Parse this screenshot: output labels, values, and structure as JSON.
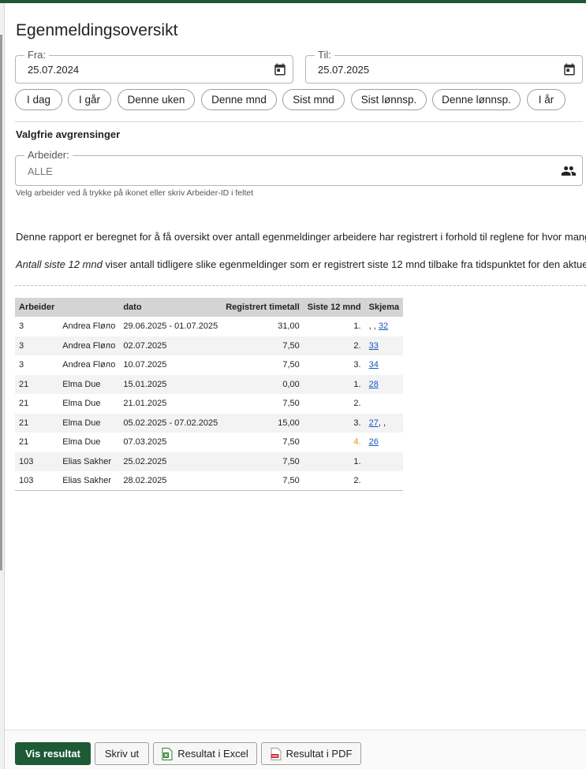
{
  "title": "Egenmeldingsoversikt",
  "date_from": {
    "label": "Fra:",
    "value": "25.07.2024"
  },
  "date_to": {
    "label": "Til:",
    "value": "25.07.2025"
  },
  "quick_ranges": [
    "I dag",
    "I går",
    "Denne uken",
    "Denne mnd",
    "Sist mnd",
    "Sist lønnsp.",
    "Denne lønnsp.",
    "I år"
  ],
  "optional_heading": "Valgfrie avgrensinger",
  "worker_field": {
    "label": "Arbeider:",
    "value": "ALLE",
    "hint": "Velg arbeider ved å trykke på ikonet eller skriv Arbeider-ID i feltet"
  },
  "description": {
    "line1": "Denne rapport er beregnet for å få oversikt over antall egenmeldinger arbeidere har registrert i forhold til reglene for hvor mange d",
    "line2_em": "Antall siste 12 mnd",
    "line2_rest": " viser antall tidligere slike egenmeldinger som er registrert siste 12 mnd tilbake fra tidspunktet for den aktuelle e"
  },
  "table": {
    "headers": [
      "Arbeider",
      "dato",
      "Registrert timetall",
      "Siste 12 mnd",
      "Skjema"
    ],
    "rows": [
      {
        "id": "3",
        "name": "Andrea Fløло",
        "date": "29.06.2025 - 01.07.2025",
        "hours": "31,00",
        "count": "1.",
        "pre": ", , ",
        "link": "32",
        "post": "",
        "warn": false
      },
      {
        "id": "3",
        "name": "Andrea Fløло",
        "date": "02.07.2025",
        "hours": "7,50",
        "count": "2.",
        "pre": "",
        "link": "33",
        "post": "",
        "warn": false
      },
      {
        "id": "3",
        "name": "Andrea Fløло",
        "date": "10.07.2025",
        "hours": "7,50",
        "count": "3.",
        "pre": "",
        "link": "34",
        "post": "",
        "warn": false
      },
      {
        "id": "21",
        "name": "Elma Due",
        "date": "15.01.2025",
        "hours": "0,00",
        "count": "1.",
        "pre": "",
        "link": "28",
        "post": "",
        "warn": false
      },
      {
        "id": "21",
        "name": "Elma Due",
        "date": "21.01.2025",
        "hours": "7,50",
        "count": "2.",
        "pre": "",
        "link": "",
        "post": "",
        "warn": false
      },
      {
        "id": "21",
        "name": "Elma Due",
        "date": "05.02.2025 - 07.02.2025",
        "hours": "15,00",
        "count": "3.",
        "pre": "",
        "link": "27",
        "post": ", ,",
        "warn": false
      },
      {
        "id": "21",
        "name": "Elma Due",
        "date": "07.03.2025",
        "hours": "7,50",
        "count": "4.",
        "pre": "",
        "link": "26",
        "post": "",
        "warn": true
      },
      {
        "id": "103",
        "name": "Elias Sakher",
        "date": "25.02.2025",
        "hours": "7,50",
        "count": "1.",
        "pre": "",
        "link": "",
        "post": "",
        "warn": false
      },
      {
        "id": "103",
        "name": "Elias Sakher",
        "date": "28.02.2025",
        "hours": "7,50",
        "count": "2.",
        "pre": "",
        "link": "",
        "post": "",
        "warn": false
      }
    ]
  },
  "footer": {
    "show_results": "Vis resultat",
    "print": "Skriv ut",
    "excel": "Resultat i Excel",
    "pdf": "Resultat i PDF"
  },
  "colors": {
    "brand": "#1d5a35",
    "link": "#1a57c7",
    "warning": "#f0900b"
  },
  "icons": {
    "calendar": "calendar-icon",
    "people": "people-icon",
    "excel": "excel-file-icon",
    "pdf": "pdf-file-icon"
  }
}
